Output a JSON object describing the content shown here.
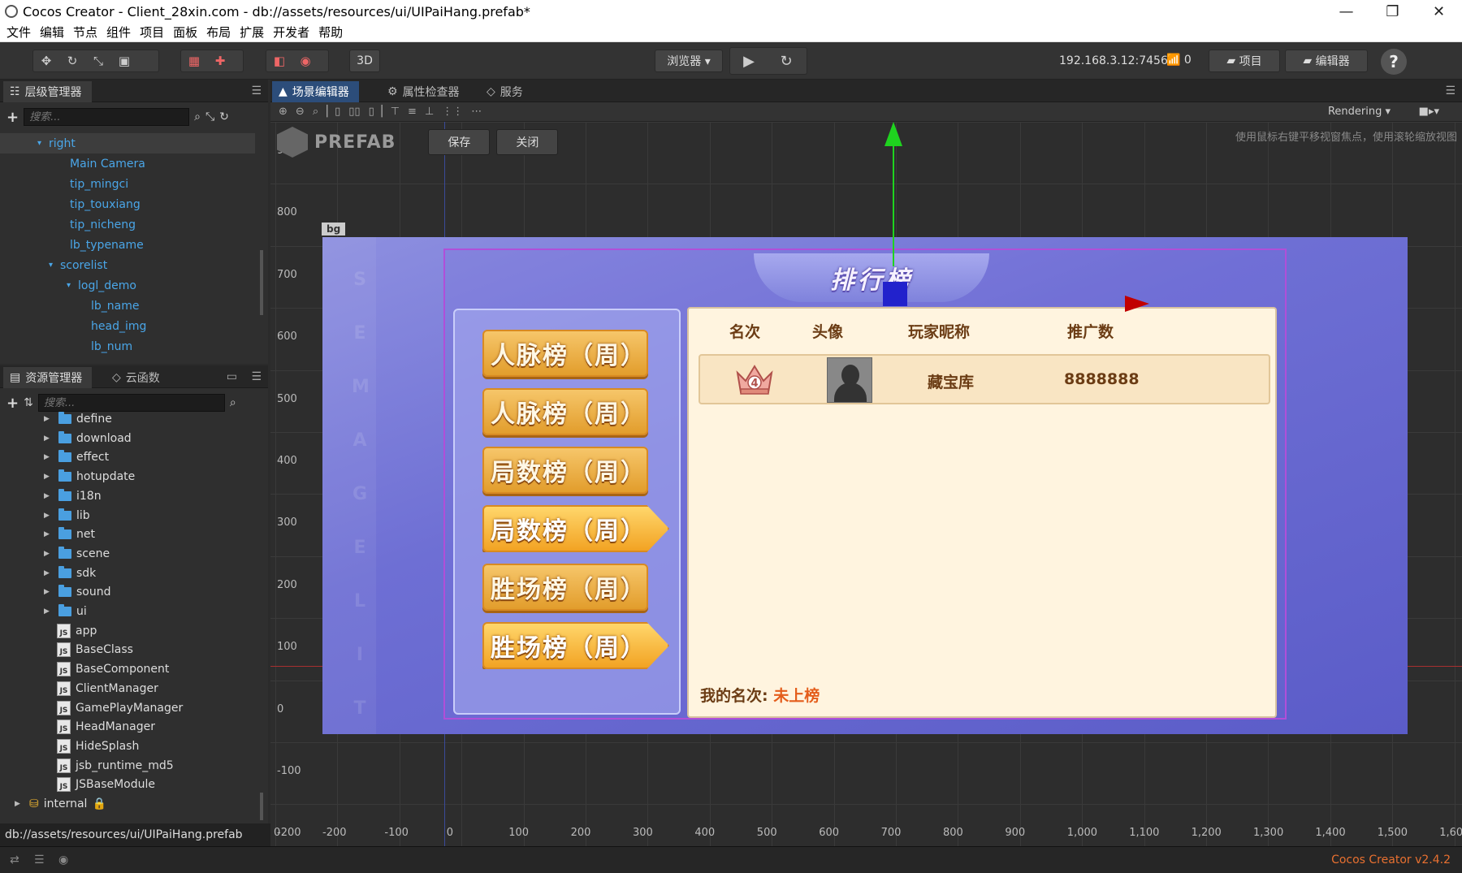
{
  "window": {
    "title": "Cocos Creator - Client_28xin.com - db://assets/resources/ui/UIPaiHang.prefab*"
  },
  "menu": [
    "文件",
    "编辑",
    "节点",
    "组件",
    "项目",
    "面板",
    "布局",
    "扩展",
    "开发者",
    "帮助"
  ],
  "toolbar": {
    "mode_3d": "3D",
    "browser": "浏览器 ▾",
    "ip": "192.168.3.12:7456",
    "conn_count": "0",
    "project_btn": "项目",
    "editor_btn": "编辑器",
    "help": "?"
  },
  "hierarchy": {
    "tab": "层级管理器",
    "search_placeholder": "搜索...",
    "items": [
      {
        "label": "right",
        "indent": 0,
        "arrow": "▾"
      },
      {
        "label": "Main Camera",
        "indent": 1,
        "arrow": ""
      },
      {
        "label": "tip_mingci",
        "indent": 1,
        "arrow": ""
      },
      {
        "label": "tip_touxiang",
        "indent": 1,
        "arrow": ""
      },
      {
        "label": "tip_nicheng",
        "indent": 1,
        "arrow": ""
      },
      {
        "label": "lb_typename",
        "indent": 1,
        "arrow": ""
      },
      {
        "label": "scorelist",
        "indent": 1,
        "arrow": "▾"
      },
      {
        "label": "logl_demo",
        "indent": 2,
        "arrow": "▾"
      },
      {
        "label": "lb_name",
        "indent": 3,
        "arrow": ""
      },
      {
        "label": "head_img",
        "indent": 3,
        "arrow": ""
      },
      {
        "label": "lb_num",
        "indent": 3,
        "arrow": ""
      }
    ]
  },
  "assets": {
    "tab": "资源管理器",
    "tab2": "云函数",
    "search_placeholder": "搜索...",
    "folders": [
      "define",
      "download",
      "effect",
      "hotupdate",
      "i18n",
      "lib",
      "net",
      "scene",
      "sdk",
      "sound",
      "ui"
    ],
    "scripts": [
      "app",
      "BaseClass",
      "BaseComponent",
      "ClientManager",
      "GamePlayManager",
      "HeadManager",
      "HideSplash",
      "jsb_runtime_md5",
      "JSBaseModule"
    ],
    "internal": "internal"
  },
  "scene": {
    "tabs": [
      "场景编辑器",
      "属性检查器",
      "服务"
    ],
    "rendering": "Rendering ▾",
    "prefab": "PREFAB",
    "save": "保存",
    "close": "关闭",
    "hint": "使用鼠标右键平移视窗焦点，使用滚轮缩放视图",
    "node_label": "bg",
    "y_labels": [
      "900",
      "800",
      "700",
      "600",
      "500",
      "400",
      "300",
      "200",
      "100",
      "0",
      "-100",
      "-200"
    ],
    "x_labels": [
      "-200",
      "-100",
      "0",
      "100",
      "200",
      "300",
      "400",
      "500",
      "600",
      "700",
      "800",
      "900",
      "1,000",
      "1,100",
      "1,200",
      "1,300",
      "1,400",
      "1,500",
      "1,60"
    ],
    "corner_label": "0"
  },
  "game": {
    "title": "排行榜",
    "deco_letters": [
      "S",
      "E",
      "M",
      "A",
      "G",
      "E",
      "L",
      "I",
      "T"
    ],
    "buttons": [
      {
        "label": "人脉榜（周）",
        "selected": false
      },
      {
        "label": "人脉榜（周）",
        "selected": false
      },
      {
        "label": "局数榜（周）",
        "selected": false
      },
      {
        "label": "局数榜（周）",
        "selected": true
      },
      {
        "label": "胜场榜（周）",
        "selected": false
      },
      {
        "label": "胜场榜（周）",
        "selected": true
      }
    ],
    "columns": [
      "名次",
      "头像",
      "玩家昵称",
      "推广数"
    ],
    "row": {
      "rank": "4",
      "name": "藏宝库",
      "count": "8888888"
    },
    "my_rank_label": "我的名次:",
    "my_rank_value": "未上榜"
  },
  "status": {
    "path": "db://assets/resources/ui/UIPaiHang.prefab",
    "version": "Cocos Creator v2.4.2"
  }
}
